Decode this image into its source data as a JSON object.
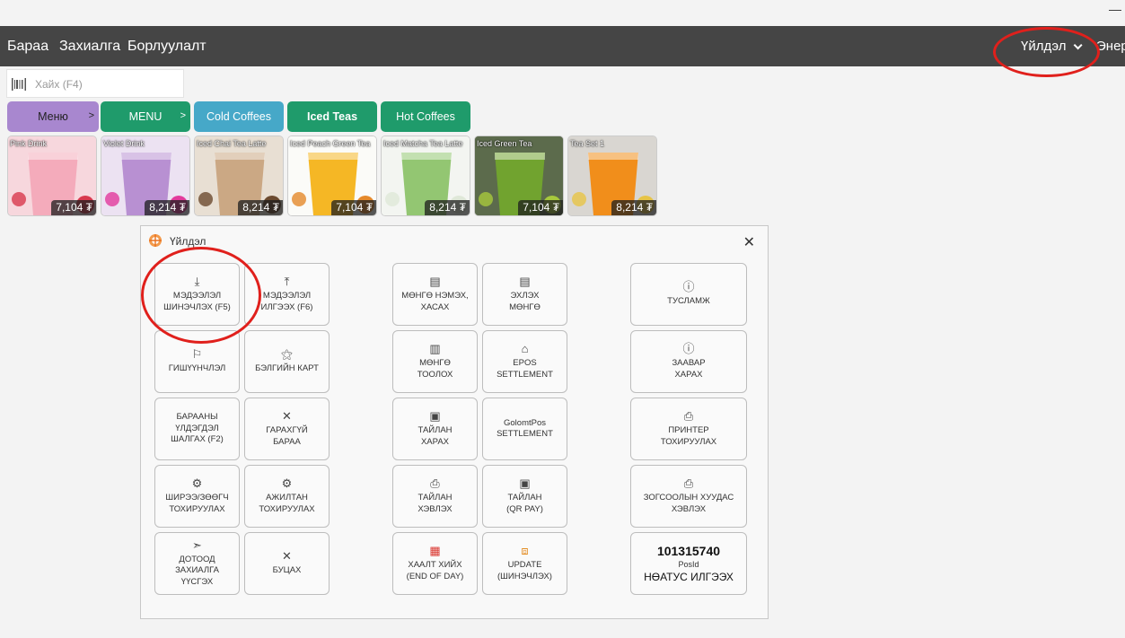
{
  "window": {
    "minimize": "—"
  },
  "nav": {
    "items": [
      "Бараа",
      "Захиалга",
      "Борлуулалт"
    ],
    "actions_label": "Үйлдэл",
    "cut_label": "Энер"
  },
  "search": {
    "placeholder": "Хайх (F4)"
  },
  "categories": [
    {
      "label": "Меню",
      "color": "#a887cf",
      "arrow": ">",
      "text_color": "#222"
    },
    {
      "label": "MENU",
      "color": "#1f9b6b",
      "arrow": ">",
      "text_color": "#fff"
    },
    {
      "label": "Cold Coffees",
      "color": "#46a8c8",
      "text_color": "#fff"
    },
    {
      "label": "Iced Teas",
      "color": "#1f9b6b",
      "text_color": "#fff"
    },
    {
      "label": "Hot Coffees",
      "color": "#1f9b6b",
      "text_color": "#fff"
    }
  ],
  "products": [
    {
      "name": "Pink Drink",
      "price": "7,104 ₮",
      "colors": [
        "#f7d7dd",
        "#f3a9b8",
        "#d8384d"
      ]
    },
    {
      "name": "Violet Drink",
      "price": "8,214 ₮",
      "colors": [
        "#ece2f2",
        "#b58bd0",
        "#e23a9c"
      ]
    },
    {
      "name": "Iced Chai Tea Latte",
      "price": "8,214 ₮",
      "colors": [
        "#e8dfd3",
        "#c9a47f",
        "#6b4a2f"
      ]
    },
    {
      "name": "Iced Peach Green Tea",
      "price": "7,104 ₮",
      "colors": [
        "#fbfbf8",
        "#f4b319",
        "#e5892b"
      ]
    },
    {
      "name": "Iced Matcha Tea Latte",
      "price": "8,214 ₮",
      "colors": [
        "#f3f5f1",
        "#8dc36a",
        "#dfe8d8"
      ]
    },
    {
      "name": "Iced Green Tea",
      "price": "7,104 ₮",
      "colors": [
        "#5c6b4c",
        "#72a62d",
        "#a7c93c"
      ]
    },
    {
      "name": "Tea Set 1",
      "price": "8,214 ₮",
      "colors": [
        "#d9d6d1",
        "#f28a11",
        "#e7c446"
      ]
    }
  ],
  "dialog": {
    "title": "Үйлдэл",
    "close": "✕",
    "tiles": {
      "download": {
        "icon": "⤓",
        "label": "МЭДЭЭЛЭЛ\nШИНЭЧЛЭХ (F5)"
      },
      "upload": {
        "icon": "⤒",
        "label": "МЭДЭЭЛЭЛ\nИЛГЭЭХ (F6)"
      },
      "membership": {
        "icon": "⚐",
        "label": "ГИШҮҮНЧЛЭЛ"
      },
      "giftcard": {
        "icon": "⚝",
        "label": "БЭЛГИЙН КАРТ"
      },
      "stock": {
        "label": "БАРААНЫ\nҮЛДЭГДЭЛ\nШАЛГАХ (F2)"
      },
      "unsold": {
        "icon": "✕",
        "label": "ГАРАХГҮЙ\nБАРАА"
      },
      "waiter": {
        "icon": "⚙",
        "label": "ШИРЭЭ/ЗӨӨГЧ\nТОХИРУУЛАХ"
      },
      "staff": {
        "icon": "⚙",
        "label": "АЖИЛТАН\nТОХИРУУЛАХ"
      },
      "internal": {
        "icon": "➣",
        "label": "ДОТООД\nЗАХИАЛГА\nҮҮСГЭХ"
      },
      "cancel": {
        "icon": "✕",
        "label": "БУЦАХ"
      },
      "cash_addsub": {
        "icon": "▤",
        "label": "МӨНГӨ НЭМЭХ,\nХАСАХ"
      },
      "start_cash": {
        "icon": "▤",
        "label": "ЭХЛЭХ\nМӨНГӨ"
      },
      "count_cash": {
        "icon": "▥",
        "label": "МӨНГӨ\nТООЛОХ"
      },
      "epos": {
        "icon": "⌂",
        "label": "EPOS\nSETTLEMENT"
      },
      "report_view": {
        "icon": "▣",
        "label": "ТАЙЛАН\nХАРАХ"
      },
      "golomt": {
        "label": "GolomtPos\nSETTLEMENT"
      },
      "report_print": {
        "icon": "⎙",
        "label": "ТАЙЛАН\nХЭВЛЭХ"
      },
      "report_qr": {
        "icon": "▣",
        "label": "ТАЙЛАН\n(QR PAY)"
      },
      "end_of_day": {
        "icon": "▦",
        "label": "ХААЛТ ХИЙХ\n(END OF DAY)",
        "icon_color": "#d9332c"
      },
      "update": {
        "icon": "⧈",
        "label": "UPDATE\n(ШИНЭЧЛЭХ)",
        "icon_color": "#e38a1e"
      },
      "help": {
        "icon": "ⓘ",
        "label": "ТУСЛАМЖ"
      },
      "guide": {
        "icon": "ⓘ",
        "label": "ЗААВАР\nХАРАХ"
      },
      "printer": {
        "icon": "⎙",
        "label": "ПРИНТЕР\nТОХИРУУЛАХ"
      },
      "kitchen_print": {
        "icon": "⎙",
        "label": "ЗОГСООЛЫН ХУУДАС\nХЭВЛЭХ"
      },
      "pos": {
        "number": "101315740",
        "small": "PosId",
        "label": "НӨАТУС ИЛГЭЭХ"
      }
    }
  }
}
